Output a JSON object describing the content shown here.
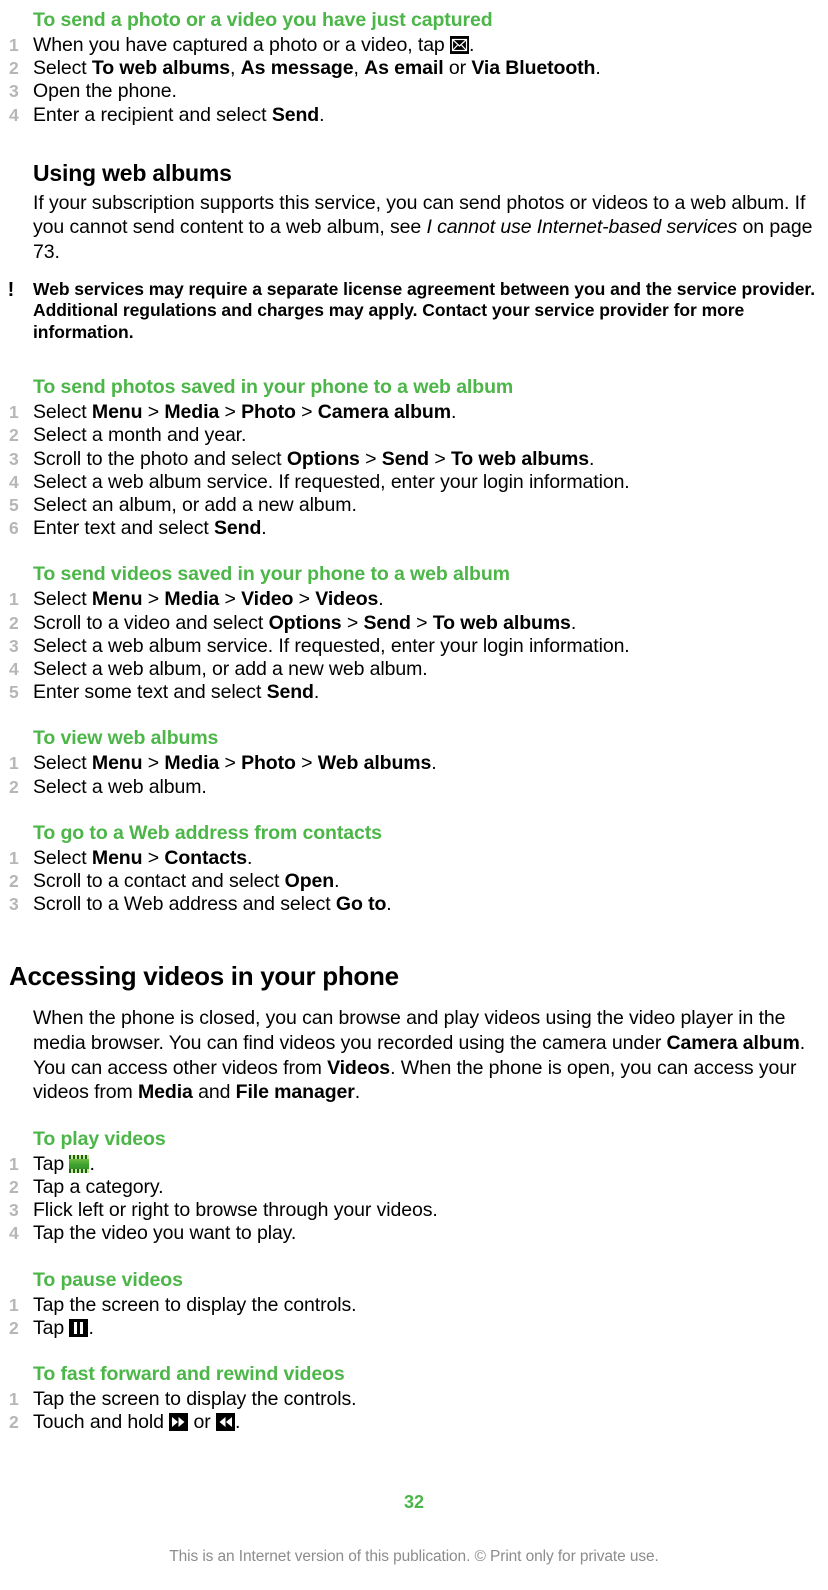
{
  "page": {
    "number": "32",
    "footnote": "This is an Internet version of this publication. © Print only for private use."
  },
  "sections": [
    {
      "id": "send-captured",
      "heading": "To send a photo or a video you have just captured",
      "steps": [
        "When you have captured a photo or a video, tap ▣.",
        "Select To web albums, As message, As email or Via Bluetooth.",
        "Open the phone.",
        "Enter a recipient and select Send."
      ]
    },
    {
      "id": "using-web-albums",
      "heading": "Using web albums",
      "body": "If your subscription supports this service, you can send photos or videos to a web album. If you cannot send content to a web album, see I cannot use Internet-based services on page 73.",
      "note": "Web services may require a separate license agreement between you and the service provider. Additional regulations and charges may apply. Contact your service provider for more information."
    },
    {
      "id": "send-photos-web-album",
      "heading": "To send photos saved in your phone to a web album",
      "steps": [
        "Select Menu > Media > Photo > Camera album.",
        "Select a month and year.",
        "Scroll to the photo and select Options > Send > To web albums.",
        "Select a web album service. If requested, enter your login information.",
        "Select an album, or add a new album.",
        "Enter text and select Send."
      ]
    },
    {
      "id": "send-videos-web-album",
      "heading": "To send videos saved in your phone to a web album",
      "steps": [
        "Select Menu > Media > Video > Videos.",
        "Scroll to a video and select Options > Send > To web albums.",
        "Select a web album service. If requested, enter your login information.",
        "Select a web album, or add a new web album.",
        "Enter some text and select Send."
      ]
    },
    {
      "id": "view-web-albums",
      "heading": "To view web albums",
      "steps": [
        "Select Menu > Media > Photo > Web albums.",
        "Select a web album."
      ]
    },
    {
      "id": "go-to-web-address",
      "heading": "To go to a Web address from contacts",
      "steps": [
        "Select Menu > Contacts.",
        "Scroll to a contact and select Open.",
        "Scroll to a Web address and select Go to."
      ]
    },
    {
      "id": "accessing-videos",
      "heading": "Accessing videos in your phone",
      "body": "When the phone is closed, you can browse and play videos using the video player in the media browser. You can find videos you recorded using the camera under Camera album. You can access other videos from Videos. When the phone is open, you can access your videos from Media and File manager."
    },
    {
      "id": "play-videos",
      "heading": "To play videos",
      "steps": [
        "Tap ▤.",
        "Tap a category.",
        "Flick left or right to browse through your videos.",
        "Tap the video you want to play."
      ]
    },
    {
      "id": "pause-videos",
      "heading": "To pause videos",
      "steps": [
        "Tap the screen to display the controls.",
        "Tap ⏸."
      ]
    },
    {
      "id": "fast-forward-rewind",
      "heading": "To fast forward and rewind videos",
      "steps": [
        "Tap the screen to display the controls.",
        "Touch and hold ⏩ or ⏪."
      ]
    }
  ],
  "text_fragments": {
    "s1_step1_a": "When you have captured a photo or a video, tap ",
    "s1_step1_b": ".",
    "s1_step2_a": "Select ",
    "s1_step2_b": "To web albums",
    "s1_step2_c": ", ",
    "s1_step2_d": "As message",
    "s1_step2_e": ", ",
    "s1_step2_f": "As email",
    "s1_step2_g": " or ",
    "s1_step2_h": "Via Bluetooth",
    "s1_step2_i": ".",
    "s1_step3": "Open the phone.",
    "s1_step4_a": "Enter a recipient and select ",
    "s1_step4_b": "Send",
    "s1_step4_c": ".",
    "s2_body_a": "If your subscription supports this service, you can send photos or videos to a web album. If you cannot send content to a web album, see ",
    "s2_body_b": "I cannot use Internet-based services",
    "s2_body_c": " on page 73.",
    "s2_note": "Web services may require a separate license agreement between you and the service provider. Additional regulations and charges may apply. Contact your service provider for more information.",
    "s3_step1_a": "Select ",
    "s3_step1_m1": "Menu",
    "s3_step1_gt1": " > ",
    "s3_step1_m2": "Media",
    "s3_step1_gt2": " > ",
    "s3_step1_m3": "Photo",
    "s3_step1_gt3": " > ",
    "s3_step1_m4": "Camera album",
    "s3_step1_end": ".",
    "s3_step2": "Select a month and year.",
    "s3_step3_a": "Scroll to the photo and select ",
    "s3_step3_m1": "Options",
    "s3_step3_gt1": " > ",
    "s3_step3_m2": "Send",
    "s3_step3_gt2": " > ",
    "s3_step3_m3": "To web albums",
    "s3_step3_end": ".",
    "s3_step4": "Select a web album service. If requested, enter your login information.",
    "s3_step5": "Select an album, or add a new album.",
    "s3_step6_a": "Enter text and select ",
    "s3_step6_b": "Send",
    "s3_step6_c": ".",
    "s4_step1_a": "Select ",
    "s4_step1_m1": "Menu",
    "s4_step1_gt1": " > ",
    "s4_step1_m2": "Media",
    "s4_step1_gt2": " > ",
    "s4_step1_m3": "Video",
    "s4_step1_gt3": " > ",
    "s4_step1_m4": "Videos",
    "s4_step1_end": ".",
    "s4_step2_a": "Scroll to a video and select ",
    "s4_step2_m1": "Options",
    "s4_step2_gt1": " > ",
    "s4_step2_m2": "Send",
    "s4_step2_gt2": " > ",
    "s4_step2_m3": "To web albums",
    "s4_step2_end": ".",
    "s4_step3": "Select a web album service. If requested, enter your login information.",
    "s4_step4": "Select a web album, or add a new web album.",
    "s4_step5_a": "Enter some text and select ",
    "s4_step5_b": "Send",
    "s4_step5_c": ".",
    "s5_step1_a": "Select ",
    "s5_step1_m1": "Menu",
    "s5_step1_gt1": " > ",
    "s5_step1_m2": "Media",
    "s5_step1_gt2": " > ",
    "s5_step1_m3": "Photo",
    "s5_step1_gt3": " > ",
    "s5_step1_m4": "Web albums",
    "s5_step1_end": ".",
    "s5_step2": "Select a web album.",
    "s6_step1_a": "Select ",
    "s6_step1_m1": "Menu",
    "s6_step1_gt1": " > ",
    "s6_step1_m2": "Contacts",
    "s6_step1_end": ".",
    "s6_step2_a": "Scroll to a contact and select ",
    "s6_step2_b": "Open",
    "s6_step2_c": ".",
    "s6_step3_a": "Scroll to a Web address and select ",
    "s6_step3_b": "Go to",
    "s6_step3_c": ".",
    "s7_body_a": "When the phone is closed, you can browse and play videos using the video player in the media browser. You can find videos you recorded using the camera under ",
    "s7_body_b": "Camera album",
    "s7_body_c": ". You can access other videos from ",
    "s7_body_d": "Videos",
    "s7_body_e": ". When the phone is open, you can access your videos from ",
    "s7_body_f": "Media",
    "s7_body_g": " and ",
    "s7_body_h": "File manager",
    "s7_body_i": ".",
    "s8_step1_a": "Tap ",
    "s8_step1_b": ".",
    "s8_step2": "Tap a category.",
    "s8_step3": "Flick left or right to browse through your videos.",
    "s8_step4": "Tap the video you want to play.",
    "s9_step1": "Tap the screen to display the controls.",
    "s9_step2_a": "Tap ",
    "s9_step2_b": ".",
    "s10_step1": "Tap the screen to display the controls.",
    "s10_step2_a": "Touch and hold ",
    "s10_step2_b": " or ",
    "s10_step2_c": "."
  },
  "icons": {
    "envelope": "envelope-icon",
    "film": "film-strip-icon",
    "pause": "pause-icon",
    "fast_forward": "fast-forward-icon",
    "rewind": "rewind-icon",
    "note_bang": "exclamation-icon"
  },
  "colors": {
    "accent_green": "#4cb648",
    "step_number": "#b6b6b6",
    "footnote": "#8c8c8c",
    "text": "#000000"
  }
}
